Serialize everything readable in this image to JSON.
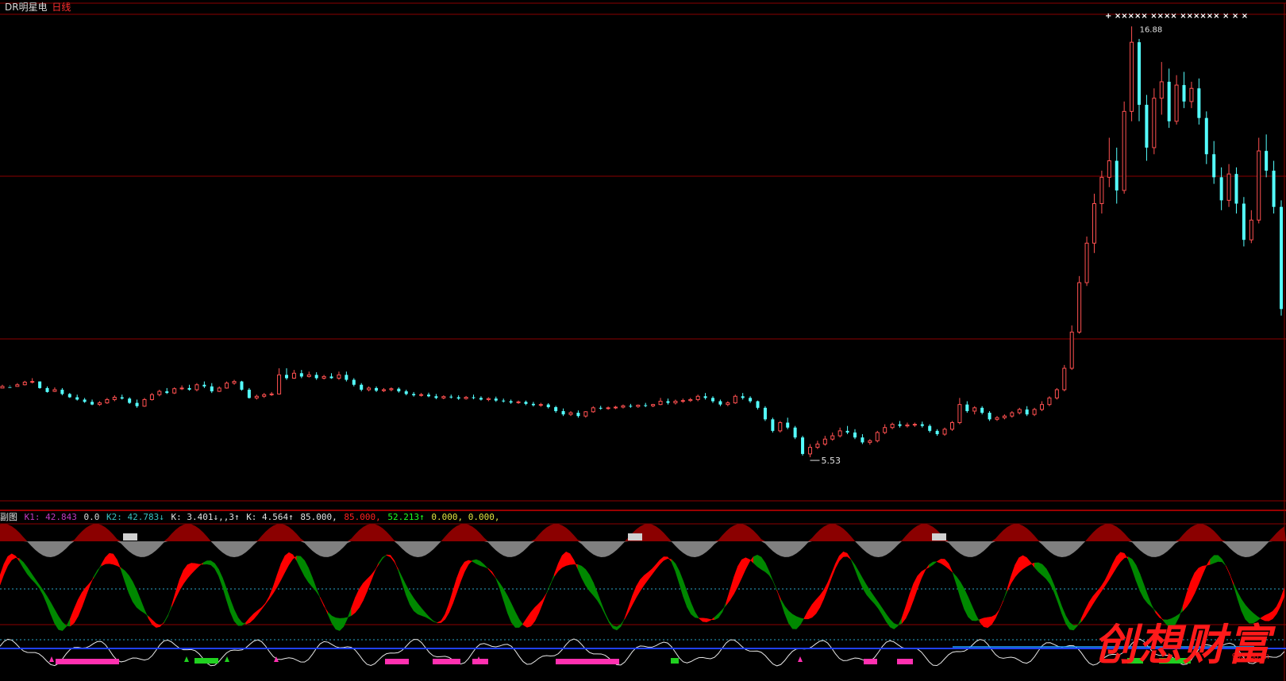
{
  "header": {
    "stock_name": "DR明星电",
    "period": "日线"
  },
  "price_panel": {
    "high_label": "16.88",
    "low_label": "5.53",
    "top_marks": "+  ×××××  ×××× ××××××  ×  ×  ×"
  },
  "indicator_panel": {
    "name": "副图",
    "items": [
      {
        "text": "K1: 42.843",
        "color": "#c03ac0"
      },
      {
        "text": "0.0",
        "color": "#d8d8d8"
      },
      {
        "text": "K2: 42.783↓",
        "color": "#3ac0c0"
      },
      {
        "text": "K: 3.401↓,,3↑",
        "color": "#e0e0e0"
      },
      {
        "text": "K: 4.564↑",
        "color": "#e0e0e0"
      },
      {
        "text": "85.000,",
        "color": "#e0e0e0"
      },
      {
        "text": "85.000,",
        "color": "#ff2020"
      },
      {
        "text": "52.213↑",
        "color": "#20ff20"
      },
      {
        "text": "0.000, 0.000,",
        "color": "#e0e040"
      }
    ]
  },
  "colors": {
    "up": "#ff5050",
    "down": "#54ffff",
    "grid": "#8b0000",
    "positive_fill": "#ff0000",
    "negative_fill": "#008800",
    "top_hump": "#8b0000",
    "bottom_hump": "#808080"
  },
  "watermark": {
    "text": "创想财富",
    "url": "995168.cn"
  },
  "chart_data": {
    "type": "candlestick",
    "series": [
      {
        "values": [
          [
            5.9,
            6.0,
            5.95,
            5.93
          ],
          [
            5.93,
            5.98,
            5.92,
            5.96
          ],
          [
            5.95,
            6.05,
            6.0,
            5.94
          ],
          [
            6.0,
            6.12,
            6.08,
            5.98
          ],
          [
            6.08,
            6.2,
            6.1,
            6.04
          ],
          [
            6.1,
            6.1,
            5.9,
            5.88
          ],
          [
            5.9,
            5.95,
            5.78,
            5.76
          ],
          [
            5.8,
            5.92,
            5.85,
            5.78
          ],
          [
            5.85,
            5.9,
            5.72,
            5.68
          ],
          [
            5.72,
            5.75,
            5.62,
            5.6
          ],
          [
            5.62,
            5.7,
            5.55,
            5.52
          ],
          [
            5.55,
            5.6,
            5.48,
            5.45
          ],
          [
            5.48,
            5.55,
            5.4,
            5.38
          ],
          [
            5.4,
            5.5,
            5.45,
            5.36
          ],
          [
            5.45,
            5.6,
            5.55,
            5.42
          ],
          [
            5.55,
            5.68,
            5.62,
            5.5
          ],
          [
            5.62,
            5.7,
            5.58,
            5.55
          ],
          [
            5.58,
            5.62,
            5.45,
            5.42
          ],
          [
            5.45,
            5.55,
            5.35,
            5.3
          ],
          [
            5.35,
            5.6,
            5.55,
            5.33
          ],
          [
            5.55,
            5.75,
            5.7,
            5.52
          ],
          [
            5.7,
            5.85,
            5.8,
            5.65
          ],
          [
            5.8,
            5.9,
            5.75,
            5.72
          ],
          [
            5.75,
            5.92,
            5.88,
            5.72
          ],
          [
            5.88,
            5.98,
            5.9,
            5.84
          ],
          [
            5.9,
            6.0,
            5.85,
            5.82
          ],
          [
            5.85,
            6.05,
            6.0,
            5.8
          ],
          [
            6.0,
            6.1,
            5.95,
            5.9
          ],
          [
            5.95,
            6.05,
            5.8,
            5.75
          ],
          [
            5.8,
            5.95,
            5.9,
            5.78
          ],
          [
            5.9,
            6.1,
            6.05,
            5.88
          ],
          [
            6.05,
            6.15,
            6.1,
            6.0
          ],
          [
            6.1,
            6.12,
            5.85,
            5.82
          ],
          [
            5.85,
            5.9,
            5.6,
            5.58
          ],
          [
            5.6,
            5.7,
            5.65,
            5.55
          ],
          [
            5.65,
            5.75,
            5.7,
            5.6
          ],
          [
            5.7,
            5.78,
            5.72,
            5.66
          ],
          [
            5.72,
            6.5,
            6.3,
            5.7
          ],
          [
            6.3,
            6.5,
            6.2,
            6.15
          ],
          [
            6.2,
            6.45,
            6.35,
            6.18
          ],
          [
            6.35,
            6.45,
            6.25,
            6.2
          ],
          [
            6.25,
            6.4,
            6.3,
            6.22
          ],
          [
            6.3,
            6.38,
            6.2,
            6.15
          ],
          [
            6.2,
            6.3,
            6.25,
            6.16
          ],
          [
            6.25,
            6.35,
            6.2,
            6.18
          ],
          [
            6.2,
            6.4,
            6.3,
            6.15
          ],
          [
            6.3,
            6.4,
            6.15,
            6.1
          ],
          [
            6.15,
            6.2,
            6.0,
            5.95
          ],
          [
            6.0,
            6.05,
            5.85,
            5.8
          ],
          [
            5.85,
            5.95,
            5.9,
            5.8
          ],
          [
            5.9,
            5.95,
            5.82,
            5.78
          ],
          [
            5.82,
            5.9,
            5.85,
            5.78
          ],
          [
            5.85,
            5.92,
            5.88,
            5.8
          ],
          [
            5.88,
            5.92,
            5.8,
            5.76
          ],
          [
            5.8,
            5.85,
            5.72,
            5.68
          ],
          [
            5.72,
            5.78,
            5.68,
            5.64
          ],
          [
            5.68,
            5.75,
            5.7,
            5.64
          ],
          [
            5.7,
            5.76,
            5.65,
            5.62
          ],
          [
            5.65,
            5.72,
            5.6,
            5.56
          ],
          [
            5.6,
            5.68,
            5.64,
            5.56
          ],
          [
            5.64,
            5.7,
            5.62,
            5.58
          ],
          [
            5.62,
            5.68,
            5.58,
            5.54
          ],
          [
            5.58,
            5.66,
            5.62,
            5.55
          ],
          [
            5.62,
            5.7,
            5.6,
            5.56
          ],
          [
            5.6,
            5.65,
            5.55,
            5.52
          ],
          [
            5.55,
            5.62,
            5.58,
            5.5
          ],
          [
            5.58,
            5.64,
            5.52,
            5.48
          ],
          [
            5.52,
            5.58,
            5.5,
            5.46
          ],
          [
            5.5,
            5.55,
            5.46,
            5.42
          ],
          [
            5.46,
            5.52,
            5.48,
            5.42
          ],
          [
            5.48,
            5.52,
            5.42,
            5.38
          ],
          [
            5.42,
            5.48,
            5.38,
            5.34
          ],
          [
            5.38,
            5.45,
            5.4,
            5.33
          ],
          [
            5.4,
            5.44,
            5.32,
            5.28
          ],
          [
            5.32,
            5.36,
            5.2,
            5.15
          ],
          [
            5.2,
            5.28,
            5.1,
            5.05
          ],
          [
            5.1,
            5.2,
            5.15,
            5.05
          ],
          [
            5.15,
            5.22,
            5.05,
            5.0
          ],
          [
            5.05,
            5.2,
            5.18,
            5.0
          ],
          [
            5.18,
            5.35,
            5.3,
            5.15
          ],
          [
            5.3,
            5.36,
            5.28,
            5.24
          ],
          [
            5.28,
            5.34,
            5.3,
            5.24
          ],
          [
            5.3,
            5.36,
            5.32,
            5.26
          ],
          [
            5.32,
            5.4,
            5.36,
            5.28
          ],
          [
            5.36,
            5.42,
            5.34,
            5.3
          ],
          [
            5.34,
            5.4,
            5.38,
            5.3
          ],
          [
            5.38,
            5.45,
            5.36,
            5.32
          ],
          [
            5.36,
            5.42,
            5.4,
            5.32
          ],
          [
            5.4,
            5.6,
            5.5,
            5.38
          ],
          [
            5.5,
            5.58,
            5.45,
            5.4
          ],
          [
            5.45,
            5.55,
            5.5,
            5.4
          ],
          [
            5.5,
            5.58,
            5.52,
            5.45
          ],
          [
            5.52,
            5.6,
            5.55,
            5.48
          ],
          [
            5.55,
            5.7,
            5.65,
            5.5
          ],
          [
            5.65,
            5.75,
            5.6,
            5.55
          ],
          [
            5.6,
            5.65,
            5.5,
            5.45
          ],
          [
            5.5,
            5.55,
            5.4,
            5.35
          ],
          [
            5.4,
            5.5,
            5.45,
            5.35
          ],
          [
            5.45,
            5.7,
            5.65,
            5.42
          ],
          [
            5.65,
            5.75,
            5.6,
            5.55
          ],
          [
            5.6,
            5.65,
            5.5,
            5.45
          ],
          [
            5.5,
            5.52,
            5.3,
            5.25
          ],
          [
            5.3,
            5.35,
            4.95,
            4.9
          ],
          [
            4.95,
            5.0,
            4.6,
            4.55
          ],
          [
            4.6,
            4.9,
            4.85,
            4.55
          ],
          [
            4.85,
            5.0,
            4.7,
            4.65
          ],
          [
            4.7,
            4.75,
            4.4,
            4.35
          ],
          [
            4.4,
            4.45,
            3.9,
            3.85
          ],
          [
            3.9,
            4.2,
            4.1,
            3.8
          ],
          [
            4.1,
            4.3,
            4.2,
            4.05
          ],
          [
            4.2,
            4.45,
            4.35,
            4.15
          ],
          [
            4.35,
            4.55,
            4.45,
            4.3
          ],
          [
            4.45,
            4.7,
            4.6,
            4.4
          ],
          [
            4.6,
            4.75,
            4.55,
            4.5
          ],
          [
            4.55,
            4.65,
            4.4,
            4.35
          ],
          [
            4.4,
            4.5,
            4.25,
            4.2
          ],
          [
            4.25,
            4.35,
            4.3,
            4.18
          ],
          [
            4.3,
            4.6,
            4.55,
            4.25
          ],
          [
            4.55,
            4.8,
            4.7,
            4.5
          ],
          [
            4.7,
            4.85,
            4.8,
            4.65
          ],
          [
            4.8,
            4.9,
            4.75,
            4.7
          ],
          [
            4.75,
            4.85,
            4.78,
            4.7
          ],
          [
            4.78,
            4.85,
            4.8,
            4.72
          ],
          [
            4.8,
            4.88,
            4.75,
            4.7
          ],
          [
            4.75,
            4.8,
            4.6,
            4.55
          ],
          [
            4.6,
            4.65,
            4.5,
            4.45
          ],
          [
            4.5,
            4.7,
            4.65,
            4.45
          ],
          [
            4.65,
            4.9,
            4.85,
            4.6
          ],
          [
            4.85,
            5.6,
            5.4,
            4.8
          ],
          [
            5.4,
            5.5,
            5.2,
            5.15
          ],
          [
            5.2,
            5.35,
            5.3,
            5.1
          ],
          [
            5.3,
            5.35,
            5.15,
            5.1
          ],
          [
            5.15,
            5.2,
            4.95,
            4.9
          ],
          [
            4.95,
            5.05,
            5.0,
            4.9
          ],
          [
            5.0,
            5.1,
            5.05,
            4.95
          ],
          [
            5.05,
            5.2,
            5.15,
            5.0
          ],
          [
            5.15,
            5.3,
            5.25,
            5.1
          ],
          [
            5.25,
            5.35,
            5.1,
            5.05
          ],
          [
            5.1,
            5.3,
            5.25,
            5.05
          ],
          [
            5.25,
            5.5,
            5.4,
            5.2
          ],
          [
            5.4,
            5.65,
            5.6,
            5.35
          ],
          [
            5.6,
            5.9,
            5.85,
            5.55
          ],
          [
            5.85,
            6.6,
            6.5,
            5.8
          ],
          [
            6.5,
            7.8,
            7.6,
            6.45
          ],
          [
            7.6,
            9.3,
            9.1,
            7.55
          ],
          [
            9.1,
            10.5,
            10.3,
            9.0
          ],
          [
            10.3,
            11.8,
            11.5,
            10.0
          ],
          [
            11.5,
            12.5,
            12.3,
            11.2
          ],
          [
            12.3,
            13.5,
            12.8,
            12.0
          ],
          [
            12.8,
            13.2,
            11.9,
            11.5
          ],
          [
            11.9,
            14.6,
            14.3,
            11.8
          ],
          [
            14.3,
            16.88,
            16.4,
            14.0
          ],
          [
            16.4,
            16.5,
            14.5,
            14.0
          ],
          [
            14.5,
            14.8,
            13.2,
            12.8
          ],
          [
            13.2,
            15.0,
            14.7,
            13.0
          ],
          [
            14.7,
            15.8,
            15.2,
            14.2
          ],
          [
            15.2,
            15.6,
            14.0,
            13.8
          ],
          [
            14.0,
            15.4,
            15.1,
            13.9
          ],
          [
            15.1,
            15.5,
            14.6,
            14.4
          ],
          [
            14.6,
            15.2,
            15.0,
            14.4
          ],
          [
            15.0,
            15.3,
            14.1,
            13.9
          ],
          [
            14.1,
            14.3,
            13.0,
            12.7
          ],
          [
            13.0,
            13.4,
            12.3,
            12.1
          ],
          [
            12.3,
            12.6,
            11.6,
            11.3
          ],
          [
            11.6,
            12.7,
            12.4,
            11.4
          ],
          [
            12.4,
            12.6,
            11.5,
            11.2
          ],
          [
            11.5,
            11.7,
            10.4,
            10.2
          ],
          [
            10.4,
            11.3,
            11.0,
            10.3
          ],
          [
            11.0,
            13.5,
            13.1,
            10.9
          ],
          [
            13.1,
            13.6,
            12.5,
            12.3
          ],
          [
            12.5,
            12.8,
            11.4,
            11.2
          ],
          [
            11.4,
            11.6,
            8.3,
            8.1
          ]
        ]
      }
    ],
    "ylim": [
      2.5,
      17.2
    ]
  }
}
